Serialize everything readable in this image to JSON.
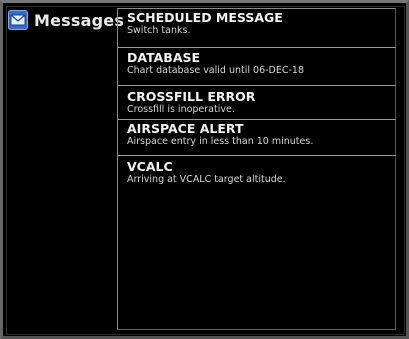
{
  "header": {
    "title": "Messages",
    "icon": "envelope-icon"
  },
  "messages": [
    {
      "title": "SCHEDULED MESSAGE",
      "body": "Switch tanks."
    },
    {
      "title": "DATABASE",
      "body": "Chart database valid until 06-DEC-18"
    },
    {
      "title": "CROSSFILL ERROR",
      "body": "Crossfill is inoperative."
    },
    {
      "title": "AIRSPACE ALERT",
      "body": "Airspace entry in less than 10 minutes."
    },
    {
      "title": "VCALC",
      "body": "Arriving at VCALC target altitude."
    }
  ],
  "colors": {
    "background": "#000000",
    "icon_accent": "#2f6fd0",
    "text": "#ffffff"
  }
}
